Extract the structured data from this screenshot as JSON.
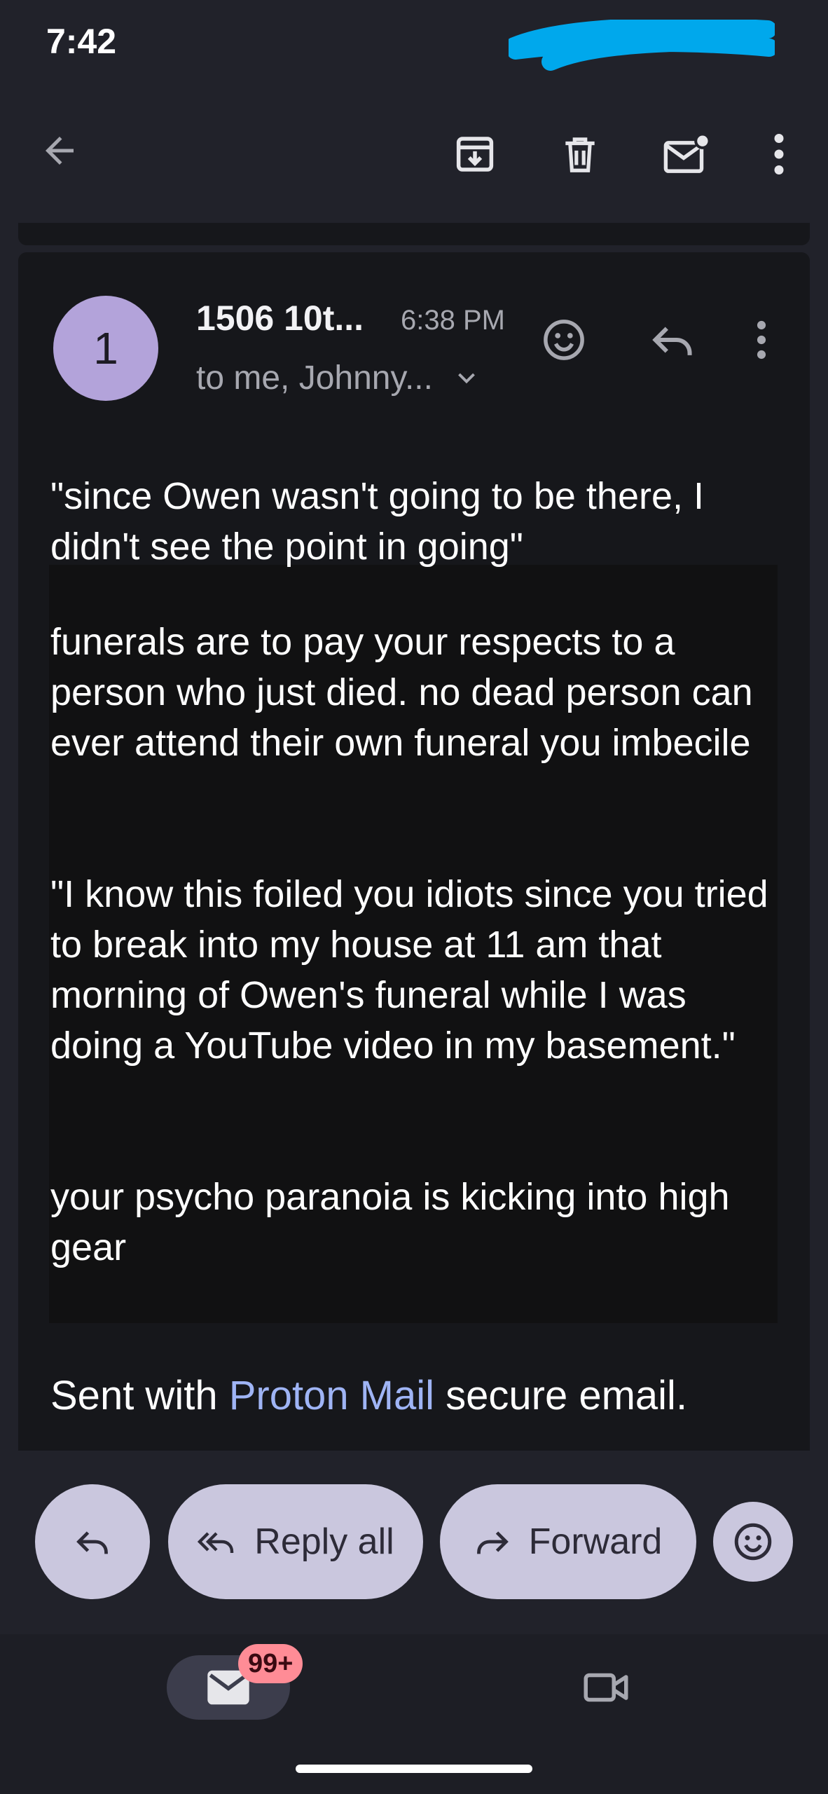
{
  "status_bar": {
    "time": "7:42"
  },
  "colors": {
    "background": "#21222a",
    "card": "#16171b",
    "avatar": "#b3a3da",
    "link": "#9fb4f5",
    "pill": "#cac7de",
    "badge": "#ff8c96",
    "redaction": "#00a8ec"
  },
  "toolbar": {
    "icons": [
      "arrow-back-icon",
      "archive-icon",
      "delete-icon",
      "mark-unread-icon",
      "more-vert-icon"
    ]
  },
  "message": {
    "avatar_letter": "1",
    "sender": "1506 10t...",
    "time": "6:38 PM",
    "recipients": "to me, Johnny...",
    "body": [
      "\"since Owen wasn't going to be there, I didn't see the point in going\"",
      "funerals are to pay your respects to a person who just died. no dead person can ever attend their own funeral you imbecile",
      "\"I know this foiled you idiots since you tried to break into my house at 11 am that morning of Owen's funeral while I was doing a YouTube video in my basement.\"",
      "your psycho paranoia is kicking into high gear"
    ],
    "signature": {
      "prefix": "Sent with ",
      "link": "Proton Mail",
      "suffix": " secure email."
    }
  },
  "actions": {
    "reply_all": "Reply all",
    "forward": "Forward"
  },
  "bottom_nav": {
    "mail_badge": "99+"
  }
}
